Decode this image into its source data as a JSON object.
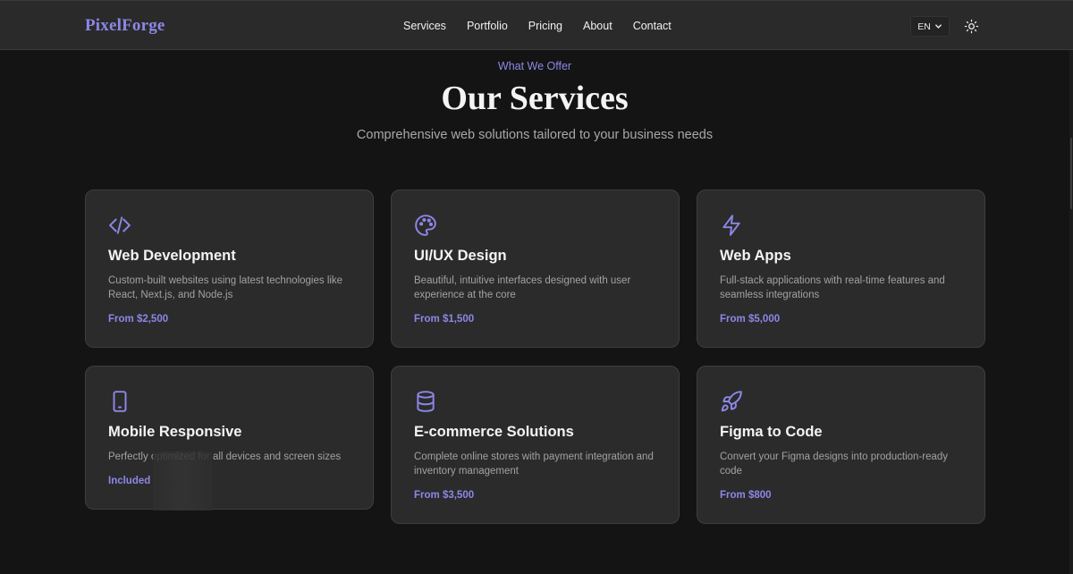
{
  "header": {
    "logo": "PixelForge",
    "nav": [
      "Services",
      "Portfolio",
      "Pricing",
      "About",
      "Contact"
    ],
    "language": "EN",
    "icons": {
      "language_caret": "chevron-down-icon",
      "theme": "sun-icon"
    }
  },
  "section": {
    "eyebrow": "What We Offer",
    "title": "Our Services",
    "subtitle": "Comprehensive web solutions tailored to your business needs"
  },
  "services": [
    {
      "icon": "code-icon",
      "title": "Web Development",
      "description": "Custom-built websites using latest technologies like React, Next.js, and Node.js",
      "price": "From $2,500"
    },
    {
      "icon": "palette-icon",
      "title": "UI/UX Design",
      "description": "Beautiful, intuitive interfaces designed with user experience at the core",
      "price": "From $1,500"
    },
    {
      "icon": "lightning-icon",
      "title": "Web Apps",
      "description": "Full-stack applications with real-time features and seamless integrations",
      "price": "From $5,000"
    },
    {
      "icon": "smartphone-icon",
      "title": "Mobile Responsive",
      "description": "Perfectly optimized for all devices and screen sizes",
      "price": "Included"
    },
    {
      "icon": "database-icon",
      "title": "E-commerce Solutions",
      "description": "Complete online stores with payment integration and inventory management",
      "price": "From $3,500"
    },
    {
      "icon": "rocket-icon",
      "title": "Figma to Code",
      "description": "Convert your Figma designs into production-ready code",
      "price": "From $800"
    }
  ],
  "colors": {
    "accent": "#8c87e6",
    "background": "#141414",
    "card": "#2b2b2b",
    "navbar": "#2a2a2a"
  }
}
